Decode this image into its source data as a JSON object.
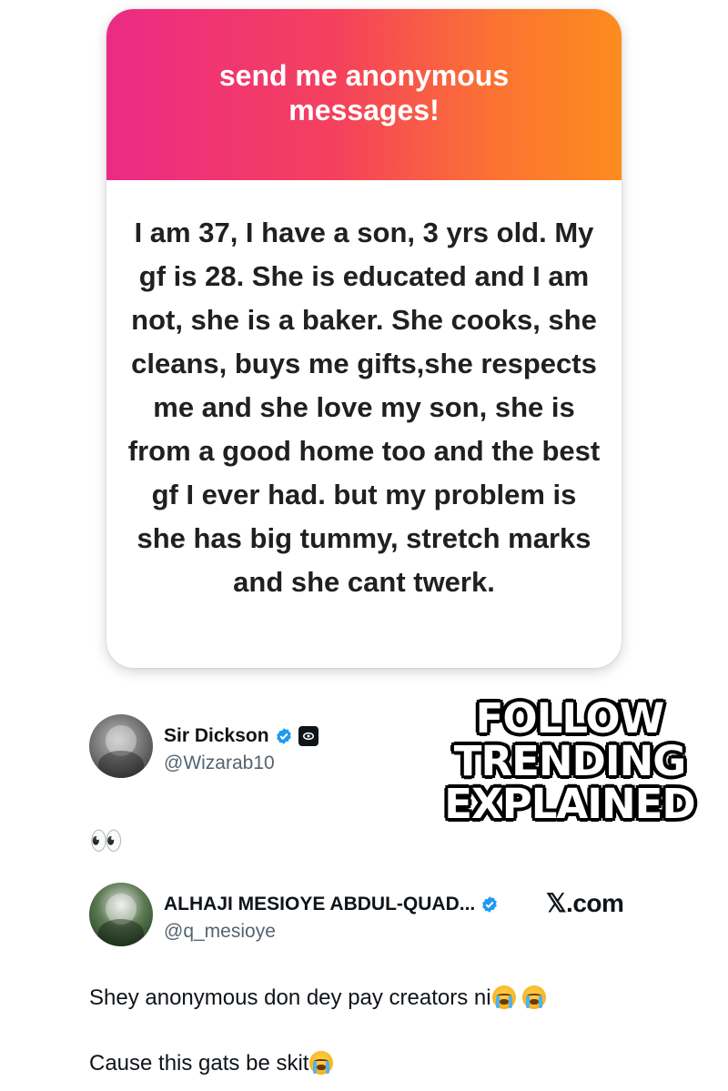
{
  "card": {
    "header_title": "send me anonymous messages!",
    "message": "I am 37, I have a son, 3 yrs old. My gf is 28. She is educated and I am not, she is a baker. She cooks, she cleans, buys me gifts,she respects me and she love my son, she is from a good home too and the best gf I ever had. but my problem is she has big tummy, stretch marks and she cant twerk.",
    "gradient_colors": [
      "#ec2a86",
      "#f4415c",
      "#fb7233",
      "#fd8c1e"
    ]
  },
  "overlay": {
    "lines": [
      "FOLLOW",
      "TRENDING",
      "EXPLAINED"
    ]
  },
  "tweets": [
    {
      "display_name": "Sir Dickson",
      "handle": "@Wizarab10",
      "verified": true,
      "affiliate_icon": "eye-badge-icon",
      "text": "👀"
    },
    {
      "display_name": "ALHAJI MESIOYE ABDUL-QUAD...",
      "handle": "@q_mesioye",
      "verified": true,
      "text_line1": "Shey anonymous don dey pay creators ni",
      "text_line2": "Cause this gats be skit"
    }
  ],
  "source_label": "𝕏.com",
  "colors": {
    "verified_blue": "#1d9bf0",
    "handle_gray": "#536471"
  }
}
